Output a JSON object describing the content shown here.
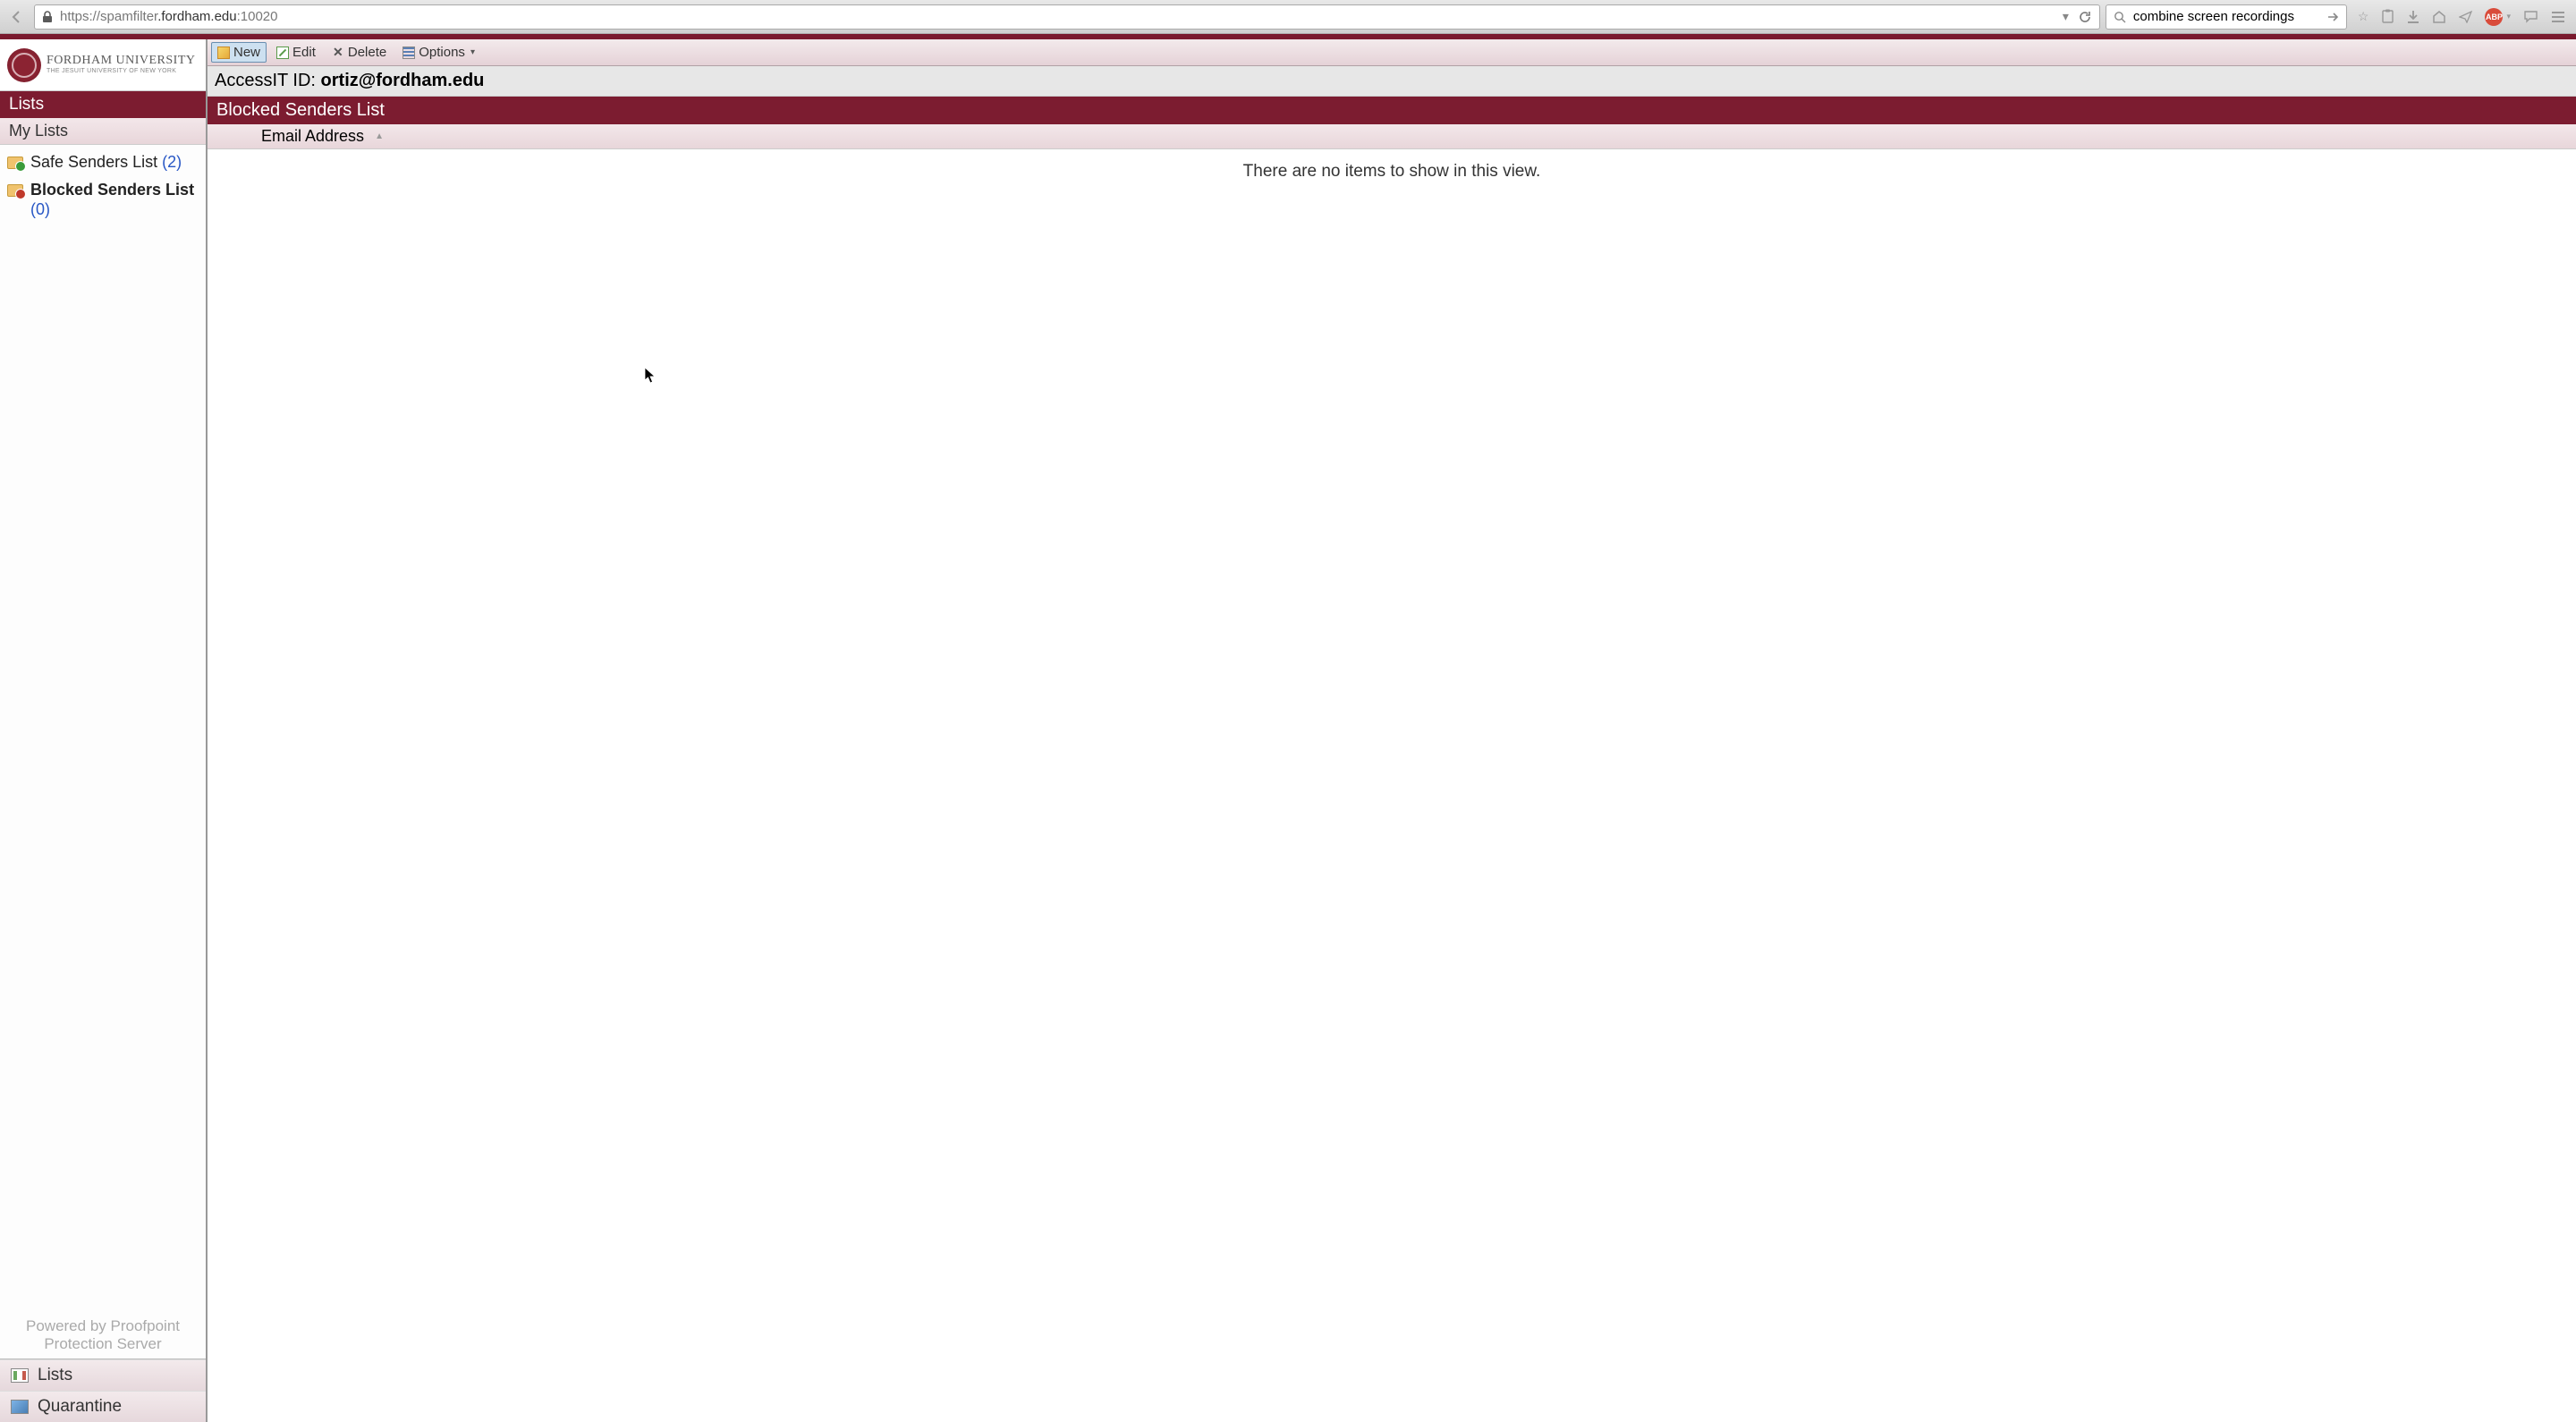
{
  "browser": {
    "url_scheme": "https://spamfilter",
    "url_host": ".fordham.edu",
    "url_port": ":10020",
    "search_value": "combine screen recordings"
  },
  "branding": {
    "name": "FORDHAM UNIVERSITY",
    "tagline": "THE JESUIT UNIVERSITY OF NEW YORK"
  },
  "sidebar": {
    "header": "Lists",
    "subheader": "My Lists",
    "items": [
      {
        "label": "Safe Senders List",
        "count": "(2)"
      },
      {
        "label": "Blocked Senders List",
        "count": "(0)"
      }
    ],
    "powered": "Powered by Proofpoint Protection Server",
    "nav": [
      {
        "label": "Lists"
      },
      {
        "label": "Quarantine"
      }
    ]
  },
  "toolbar": {
    "new": "New",
    "edit": "Edit",
    "delete": "Delete",
    "options": "Options"
  },
  "access": {
    "label": "AccessIT ID: ",
    "value": "ortiz@fordham.edu"
  },
  "content": {
    "title": "Blocked Senders List",
    "column": "Email Address",
    "empty": "There are no items to show in this view."
  }
}
